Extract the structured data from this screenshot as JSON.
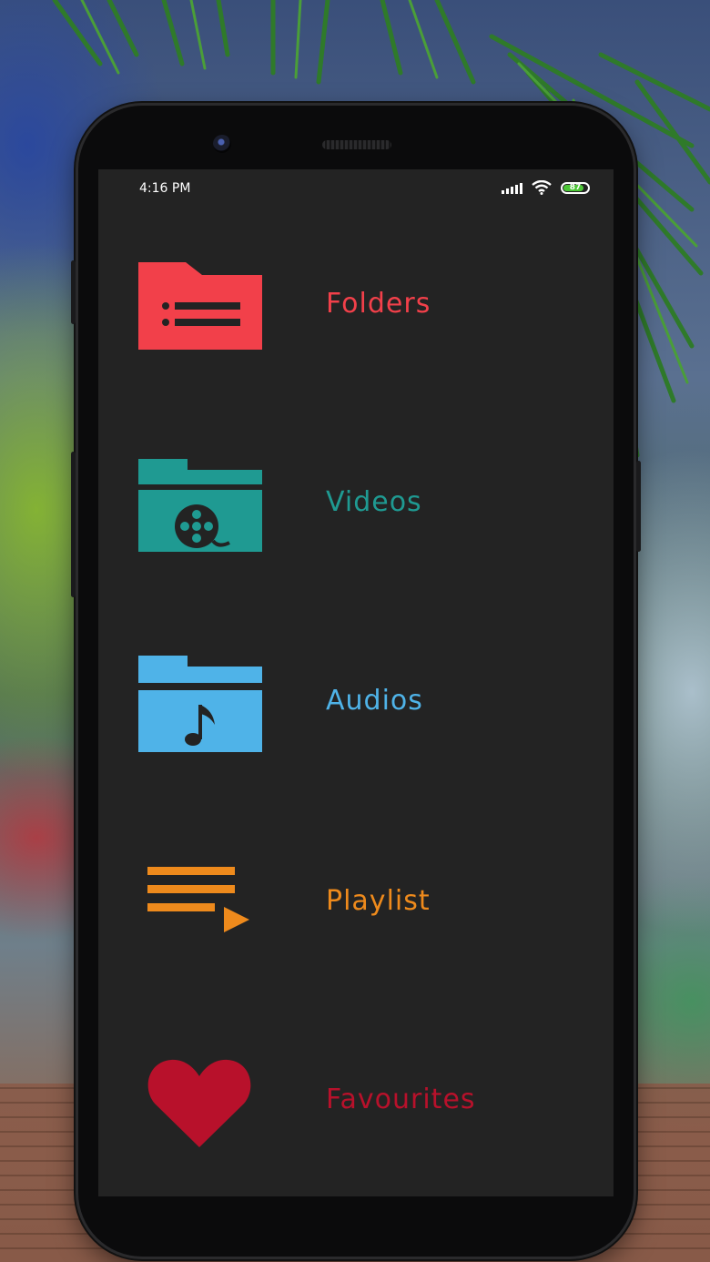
{
  "status_bar": {
    "time": "4:16 PM",
    "battery_level": "87"
  },
  "menu": [
    {
      "label": "Folders",
      "icon": "folder-list-icon",
      "color": "#f2404a"
    },
    {
      "label": "Videos",
      "icon": "video-folder-icon",
      "color": "#1f9a92"
    },
    {
      "label": "Audios",
      "icon": "audio-folder-icon",
      "color": "#4fb3e8"
    },
    {
      "label": "Playlist",
      "icon": "playlist-icon",
      "color": "#ee8a1c"
    },
    {
      "label": "Favourites",
      "icon": "heart-icon",
      "color": "#b8112b"
    }
  ],
  "colors": {
    "screen_bg": "#232323",
    "battery_green": "#4cc636"
  }
}
